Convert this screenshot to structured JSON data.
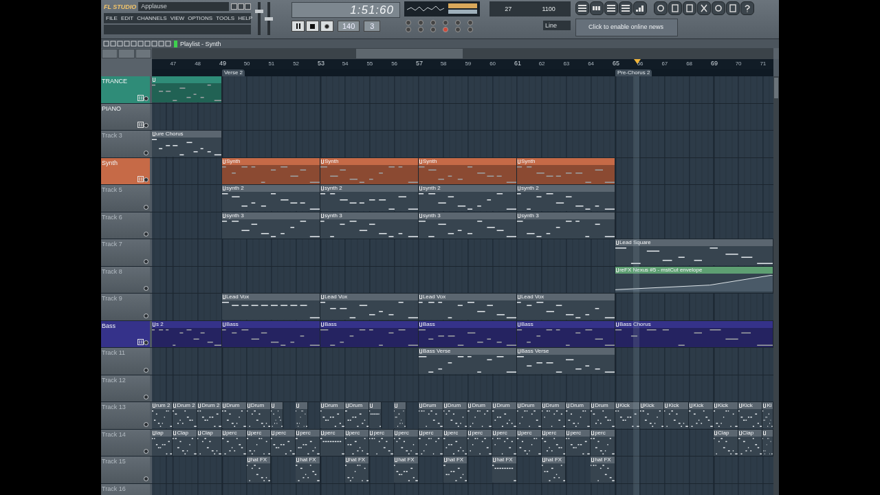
{
  "app": {
    "logo": "FL STUDIO",
    "title": "Applause",
    "menu": [
      "FILE",
      "EDIT",
      "CHANNELS",
      "VIEW",
      "OPTIONS",
      "TOOLS",
      "HELP"
    ]
  },
  "mixer": {
    "volume": {
      "level": 0.75
    },
    "pitch": {
      "level": 0.5
    }
  },
  "transport": {
    "time": "1:51:60",
    "tempo": "140",
    "pattern": "3",
    "cpu": "27",
    "memory": "1100",
    "snap": "Line",
    "news": "Click to enable online news"
  },
  "playlist": {
    "title": "Playlist - Synth",
    "ruler": [
      "47",
      "48",
      "49",
      "50",
      "51",
      "52",
      "53",
      "54",
      "55",
      "56",
      "57",
      "58",
      "59",
      "60",
      "61",
      "62",
      "63",
      "64",
      "65",
      "66",
      "67",
      "68",
      "69",
      "70",
      "71"
    ],
    "markers": [
      {
        "label": "Verse 2"
      },
      {
        "label": "Pre-Chorus 2"
      }
    ],
    "tracks": [
      {
        "name": "TRANCE",
        "color": "#2f8c78",
        "dimmed": false,
        "channel_icon": true,
        "clips": [
          {
            "kind": "pattern"
          }
        ]
      },
      {
        "name": "PIANO",
        "dimmed": false,
        "channel_icon": true
      },
      {
        "name": "Track 3",
        "dimmed": true,
        "channel_icon": false,
        "clips": [
          {
            "kind": "pattern",
            "label": "ure Chorus"
          }
        ]
      },
      {
        "name": "Synth",
        "color": "#c66a47",
        "dimmed": false,
        "channel_icon": true,
        "clips": [
          {
            "kind": "pattern",
            "label": "Synth"
          },
          {
            "kind": "pattern",
            "label": "Synth"
          },
          {
            "kind": "pattern",
            "label": "Synth"
          },
          {
            "kind": "pattern",
            "label": "Synth"
          }
        ]
      },
      {
        "name": "Track 5",
        "dimmed": true,
        "channel_icon": false,
        "clips": [
          {
            "kind": "pattern",
            "label": "synth 2"
          },
          {
            "kind": "pattern",
            "label": "synth 2"
          },
          {
            "kind": "pattern",
            "label": "synth 2"
          },
          {
            "kind": "pattern",
            "label": "synth 2"
          }
        ]
      },
      {
        "name": "Track 6",
        "dimmed": true,
        "channel_icon": false,
        "clips": [
          {
            "kind": "pattern",
            "label": "synth 3"
          },
          {
            "kind": "pattern",
            "label": "synth 3"
          },
          {
            "kind": "pattern",
            "label": "synth 3"
          },
          {
            "kind": "pattern",
            "label": "synth 3"
          }
        ]
      },
      {
        "name": "Track 7",
        "dimmed": true,
        "channel_icon": false,
        "clips": [
          {
            "kind": "pattern",
            "label": "Lead Square"
          }
        ]
      },
      {
        "name": "Track 8",
        "dimmed": true,
        "channel_icon": false,
        "clips": [
          {
            "kind": "automation",
            "label": "reFX Nexus #5 - mstCut envelope"
          }
        ]
      },
      {
        "name": "Track 9",
        "dimmed": true,
        "channel_icon": false,
        "clips": [
          {
            "kind": "pattern",
            "label": "Lead Vox"
          },
          {
            "kind": "pattern",
            "label": "Lead Vox"
          },
          {
            "kind": "pattern",
            "label": "Lead Vox"
          },
          {
            "kind": "pattern",
            "label": "Lead Vox"
          }
        ]
      },
      {
        "name": "Bass",
        "color": "#35328a",
        "dimmed": false,
        "channel_icon": true,
        "clips": [
          {
            "kind": "pattern",
            "label": "s 2"
          },
          {
            "kind": "pattern",
            "label": "Bass"
          },
          {
            "kind": "pattern",
            "label": "Bass"
          },
          {
            "kind": "pattern",
            "label": "Bass"
          },
          {
            "kind": "pattern",
            "label": "Bass"
          },
          {
            "kind": "pattern",
            "label": "Bass Chorus"
          }
        ]
      },
      {
        "name": "Track 11",
        "dimmed": true,
        "channel_icon": false,
        "clips": [
          {
            "kind": "pattern",
            "label": "Bass Verse"
          },
          {
            "kind": "pattern",
            "label": "Bass Verse"
          }
        ]
      },
      {
        "name": "Track 12",
        "dimmed": true,
        "channel_icon": false
      },
      {
        "name": "Track 13",
        "dimmed": true,
        "channel_icon": false,
        "clips": [
          {
            "kind": "pattern",
            "label": "rum 2"
          },
          {
            "kind": "pattern",
            "label": "Drum 2"
          },
          {
            "kind": "pattern",
            "label": "Drum 2"
          },
          {
            "kind": "pattern",
            "label": "Drum"
          },
          {
            "kind": "pattern",
            "label": "Drum"
          },
          {
            "kind": "pattern"
          },
          {
            "kind": "pattern"
          },
          {
            "kind": "pattern",
            "label": "Drum"
          },
          {
            "kind": "pattern",
            "label": "Drum"
          },
          {
            "kind": "pattern"
          },
          {
            "kind": "pattern"
          },
          {
            "kind": "pattern",
            "label": "Drum"
          },
          {
            "kind": "pattern",
            "label": "Drum"
          },
          {
            "kind": "pattern",
            "label": "Drum"
          },
          {
            "kind": "pattern",
            "label": "Drum"
          },
          {
            "kind": "pattern",
            "label": "Drum"
          },
          {
            "kind": "pattern",
            "label": "Drum"
          },
          {
            "kind": "pattern",
            "label": "Drum"
          },
          {
            "kind": "pattern",
            "label": "Drum"
          },
          {
            "kind": "pattern",
            "label": "Kick"
          },
          {
            "kind": "pattern",
            "label": "Kick"
          },
          {
            "kind": "pattern",
            "label": "Kick"
          },
          {
            "kind": "pattern",
            "label": "Kick"
          },
          {
            "kind": "pattern",
            "label": "Kick"
          },
          {
            "kind": "pattern",
            "label": "Kick"
          },
          {
            "kind": "pattern",
            "label": "Ki"
          }
        ]
      },
      {
        "name": "Track 14",
        "dimmed": true,
        "channel_icon": false,
        "clips": [
          {
            "kind": "pattern",
            "label": "lap"
          },
          {
            "kind": "pattern",
            "label": "Clap"
          },
          {
            "kind": "pattern",
            "label": "Clap"
          },
          {
            "kind": "pattern",
            "label": "perc"
          },
          {
            "kind": "pattern",
            "label": "perc"
          },
          {
            "kind": "pattern",
            "label": "perc"
          },
          {
            "kind": "pattern",
            "label": "perc"
          },
          {
            "kind": "pattern",
            "label": "perc"
          },
          {
            "kind": "pattern",
            "label": "perc"
          },
          {
            "kind": "pattern",
            "label": "perc"
          },
          {
            "kind": "pattern",
            "label": "perc"
          },
          {
            "kind": "pattern",
            "label": "perc"
          },
          {
            "kind": "pattern",
            "label": "perc"
          },
          {
            "kind": "pattern",
            "label": "perc"
          },
          {
            "kind": "pattern",
            "label": "perc"
          },
          {
            "kind": "pattern",
            "label": "perc"
          },
          {
            "kind": "pattern",
            "label": "perc"
          },
          {
            "kind": "pattern",
            "label": "perc"
          },
          {
            "kind": "pattern",
            "label": "perc"
          },
          {
            "kind": "pattern",
            "label": "Clap"
          },
          {
            "kind": "pattern",
            "label": "Clap"
          },
          {
            "kind": "pattern"
          }
        ]
      },
      {
        "name": "Track 15",
        "dimmed": true,
        "channel_icon": false,
        "clips": [
          {
            "kind": "pattern",
            "label": "hat FX"
          },
          {
            "kind": "pattern",
            "label": "hat FX"
          },
          {
            "kind": "pattern",
            "label": "hat FX"
          },
          {
            "kind": "pattern",
            "label": "hat FX"
          },
          {
            "kind": "pattern",
            "label": "hat FX"
          },
          {
            "kind": "pattern",
            "label": "hat FX"
          },
          {
            "kind": "pattern",
            "label": "hat FX"
          },
          {
            "kind": "pattern",
            "label": "hat FX"
          }
        ]
      },
      {
        "name": "Track 16",
        "dimmed": true,
        "channel_icon": false
      }
    ]
  }
}
